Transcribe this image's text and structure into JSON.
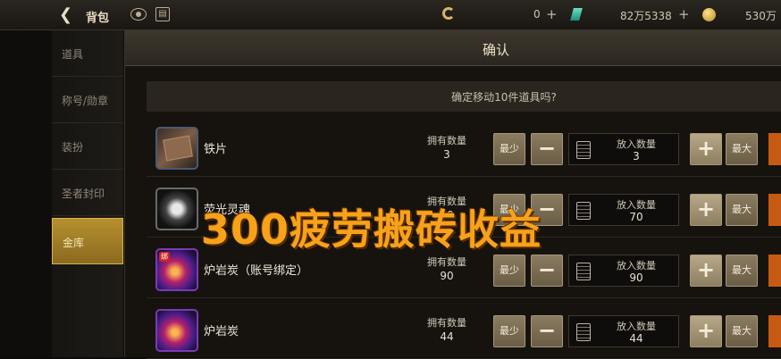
{
  "topbar": {
    "title": "背包",
    "currency1": "0",
    "currency2": "82万5338",
    "currency3": "530万"
  },
  "sidebar": {
    "items": [
      {
        "label": "道具"
      },
      {
        "label": "称号/勋章"
      },
      {
        "label": "装扮"
      },
      {
        "label": "圣者封印"
      },
      {
        "label": "金库"
      }
    ]
  },
  "dialog": {
    "title": "确认",
    "prompt": "确定移动10件道具吗?",
    "own_label": "拥有数量",
    "put_label": "放入数量",
    "min_label": "最少",
    "max_label": "最大",
    "minus": "−",
    "plus": "+",
    "rows": [
      {
        "name": "铁片",
        "own": "3",
        "put": "3",
        "icon": "iron-piece-icon"
      },
      {
        "name": "荧光灵魂",
        "own": "70",
        "put": "70",
        "icon": "orb-icon"
      },
      {
        "name": "炉岩炭（账号绑定）",
        "own": "90",
        "put": "90",
        "icon": "coal-icon",
        "badge": "绑"
      },
      {
        "name": "炉岩炭",
        "own": "44",
        "put": "44",
        "icon": "coal-icon"
      }
    ]
  },
  "overlay": {
    "text": "300疲劳搬砖收益"
  },
  "colors": {
    "accent": "#f7a21b",
    "gold": "#b6902f",
    "orange_button": "#c75a12"
  }
}
